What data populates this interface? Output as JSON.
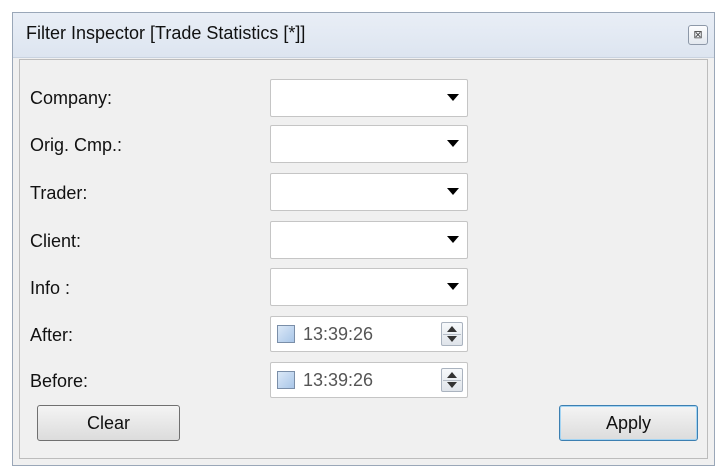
{
  "window": {
    "title": "Filter Inspector [Trade Statistics [*]]",
    "close_glyph": "⊠"
  },
  "fields": [
    {
      "label": "Company:",
      "type": "combo",
      "value": ""
    },
    {
      "label": "Orig. Cmp.:",
      "type": "combo",
      "value": ""
    },
    {
      "label": "Trader:",
      "type": "combo",
      "value": ""
    },
    {
      "label": "Client:",
      "type": "combo",
      "value": ""
    },
    {
      "label": "Info :",
      "type": "combo",
      "value": ""
    },
    {
      "label": "After:",
      "type": "time",
      "checked": false,
      "value": "13:39:26"
    },
    {
      "label": "Before:",
      "type": "time",
      "checked": false,
      "value": "13:39:26"
    }
  ],
  "buttons": {
    "clear": "Clear",
    "apply": "Apply"
  },
  "colors": {
    "titlebar": "#dde5f0",
    "accent_border": "#3c7fb1"
  }
}
